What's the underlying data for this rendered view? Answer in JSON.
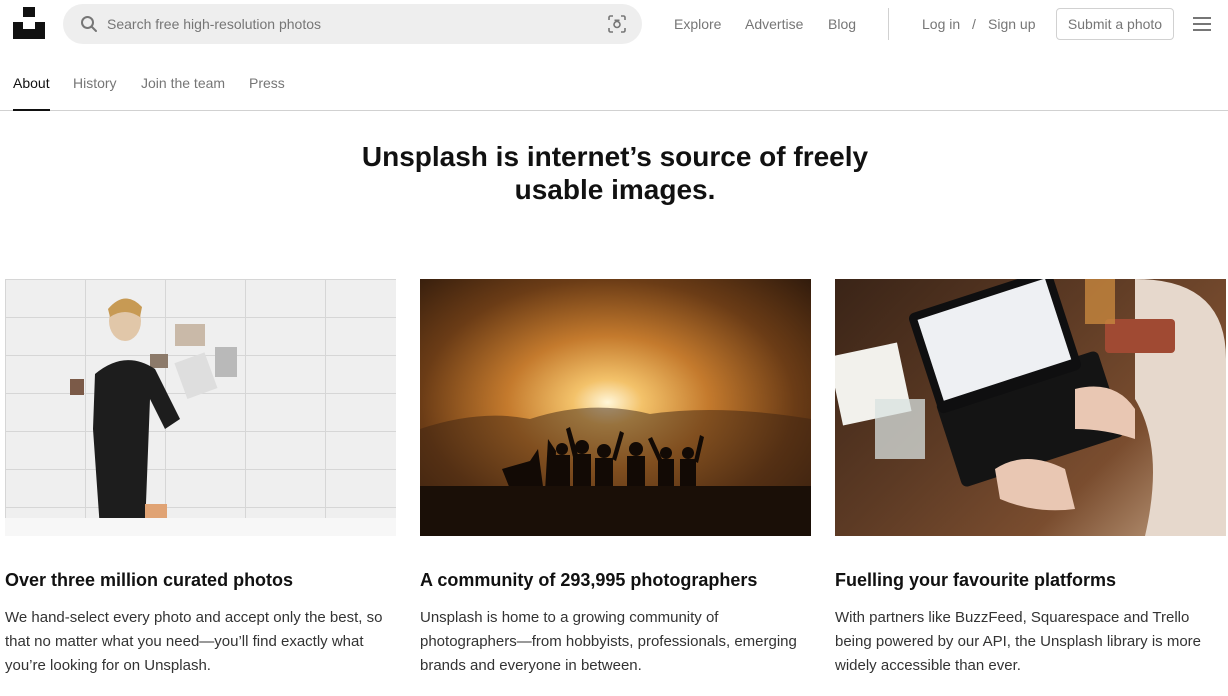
{
  "header": {
    "search_placeholder": "Search free high-resolution photos",
    "nav": {
      "explore": "Explore",
      "advertise": "Advertise",
      "blog": "Blog",
      "login": "Log in",
      "separator": "/",
      "signup": "Sign up",
      "submit": "Submit a photo"
    },
    "icons": [
      "unsplash-logo",
      "search-icon",
      "visual-search-icon",
      "hamburger-menu-icon"
    ]
  },
  "tabs": [
    {
      "label": "About",
      "active": true
    },
    {
      "label": "History",
      "active": false
    },
    {
      "label": "Join the team",
      "active": false
    },
    {
      "label": "Press",
      "active": false
    }
  ],
  "headline": {
    "line1": "Unsplash is internet’s source of freely",
    "line2": "usable images."
  },
  "cards": [
    {
      "title": "Over three million curated photos",
      "body": "We hand-select every photo and accept only the best, so that no matter what you need—you’ll find exactly what you’re looking for on Unsplash."
    },
    {
      "title": "A community of 293,995 photographers",
      "body": "Unsplash is home to a growing community of photographers—from hobbyists, professionals, emerging brands and everyone in between."
    },
    {
      "title": "Fuelling your favourite platforms",
      "body": "With partners like BuzzFeed, Squarespace and Trello being powered by our API, the Unsplash library is more widely accessible than ever."
    }
  ],
  "colors": {
    "text": "#111111",
    "muted": "#767676",
    "border": "#d1d1d1",
    "search_bg": "#eeeeee"
  }
}
